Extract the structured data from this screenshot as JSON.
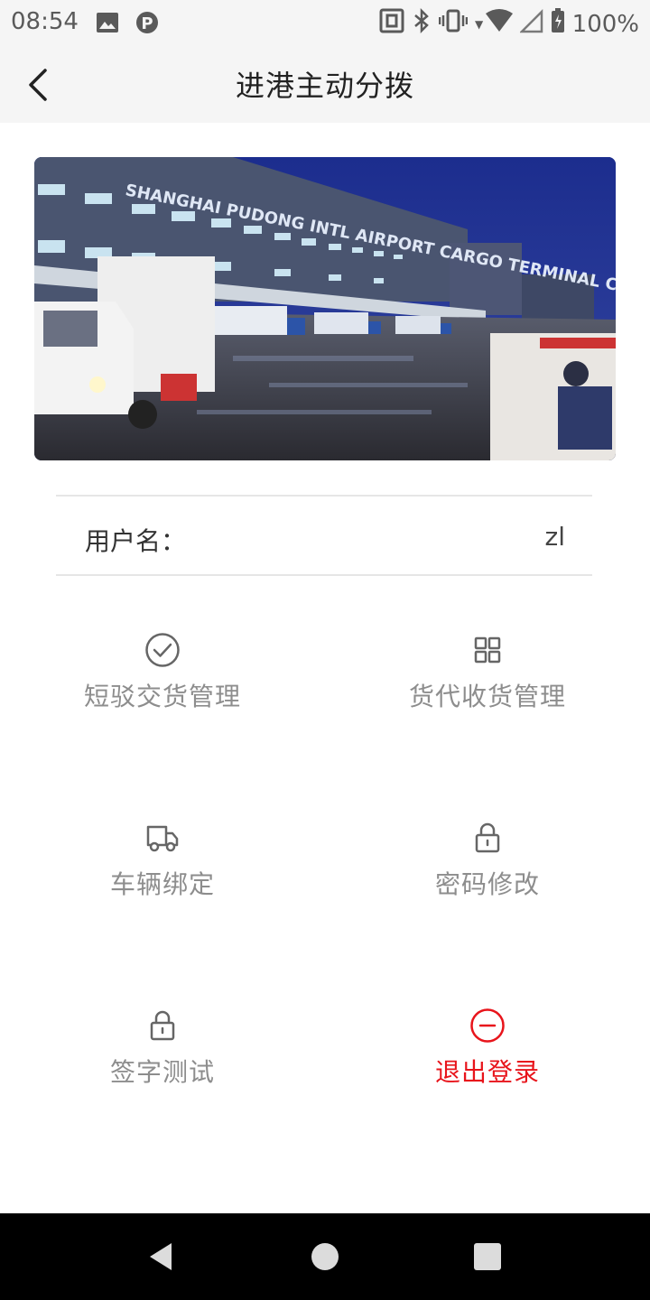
{
  "status_bar": {
    "time": "08:54",
    "battery": "100%",
    "icons": [
      "image-icon",
      "parking-icon",
      "nfc-icon",
      "bluetooth-icon",
      "vibrate-icon",
      "wifi-icon",
      "signal-icon",
      "battery-icon"
    ]
  },
  "app_bar": {
    "title": "进港主动分拨",
    "back_icon": "back-arrow-icon"
  },
  "banner": {
    "sign_text": "SHANGHAI PUDONG INTL AIRPORT CARGO TERMINAL CO.,LTD"
  },
  "user": {
    "label": "用户名：",
    "value": "zl"
  },
  "menu": [
    {
      "label": "短驳交货管理",
      "icon": "check-circle-icon"
    },
    {
      "label": "货代收货管理",
      "icon": "grid-icon"
    },
    {
      "label": "车辆绑定",
      "icon": "truck-icon"
    },
    {
      "label": "密码修改",
      "icon": "lock-icon"
    },
    {
      "label": "签字测试",
      "icon": "lock-icon"
    },
    {
      "label": "退出登录",
      "icon": "minus-circle-icon"
    }
  ],
  "colors": {
    "logout": "#e8141b",
    "menu_text": "#8d8d8d",
    "icon": "#666666"
  },
  "nav_bar": {
    "icons": [
      "back-triangle-icon",
      "home-circle-icon",
      "recents-square-icon"
    ]
  }
}
